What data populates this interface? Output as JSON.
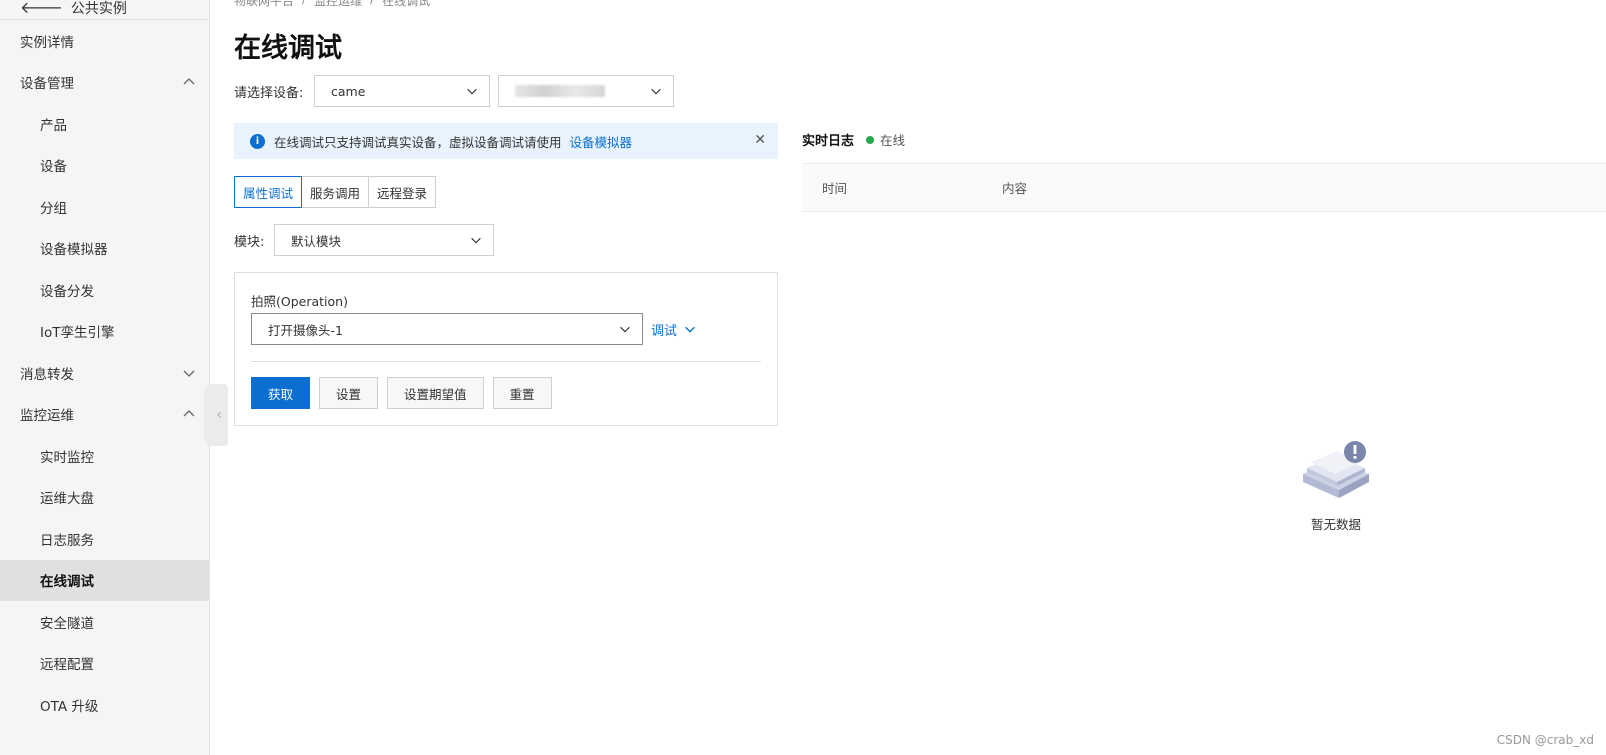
{
  "sidebar": {
    "back_label": "公共实例",
    "items": [
      {
        "label": "实例详情",
        "level": 1
      },
      {
        "label": "设备管理",
        "level": 1,
        "chevron": "up"
      },
      {
        "label": "产品",
        "level": 2
      },
      {
        "label": "设备",
        "level": 2
      },
      {
        "label": "分组",
        "level": 2
      },
      {
        "label": "设备模拟器",
        "level": 2
      },
      {
        "label": "设备分发",
        "level": 2
      },
      {
        "label": "IoT孪生引擎",
        "level": 2
      },
      {
        "label": "消息转发",
        "level": 1,
        "chevron": "down"
      },
      {
        "label": "监控运维",
        "level": 1,
        "chevron": "up"
      },
      {
        "label": "实时监控",
        "level": 2
      },
      {
        "label": "运维大盘",
        "level": 2
      },
      {
        "label": "日志服务",
        "level": 2
      },
      {
        "label": "在线调试",
        "level": 2,
        "active": true
      },
      {
        "label": "安全隧道",
        "level": 2
      },
      {
        "label": "远程配置",
        "level": 2
      },
      {
        "label": "OTA 升级",
        "level": 2
      }
    ]
  },
  "breadcrumb": [
    "物联网平台",
    "监控运维",
    "在线调试"
  ],
  "page_title": "在线调试",
  "device_select": {
    "label": "请选择设备:",
    "product_value": "came"
  },
  "notice": {
    "text": "在线调试只支持调试真实设备，虚拟设备调试请使用",
    "link": "设备模拟器"
  },
  "tabs": [
    "属性调试",
    "服务调用",
    "远程登录"
  ],
  "module": {
    "label": "模块:",
    "value": "默认模块"
  },
  "operation": {
    "title": "拍照(Operation)",
    "value": "打开摄像头-1",
    "debug_label": "调试",
    "buttons": {
      "get": "获取",
      "set": "设置",
      "set_expected": "设置期望值",
      "reset": "重置"
    }
  },
  "log": {
    "title": "实时日志",
    "status": "在线",
    "col_time": "时间",
    "col_content": "内容",
    "empty_text": "暂无数据"
  },
  "watermark": "CSDN @crab_xd",
  "colors": {
    "primary": "#0a6fd1",
    "online": "#27a84a",
    "notice_bg": "#e8f3fd"
  }
}
